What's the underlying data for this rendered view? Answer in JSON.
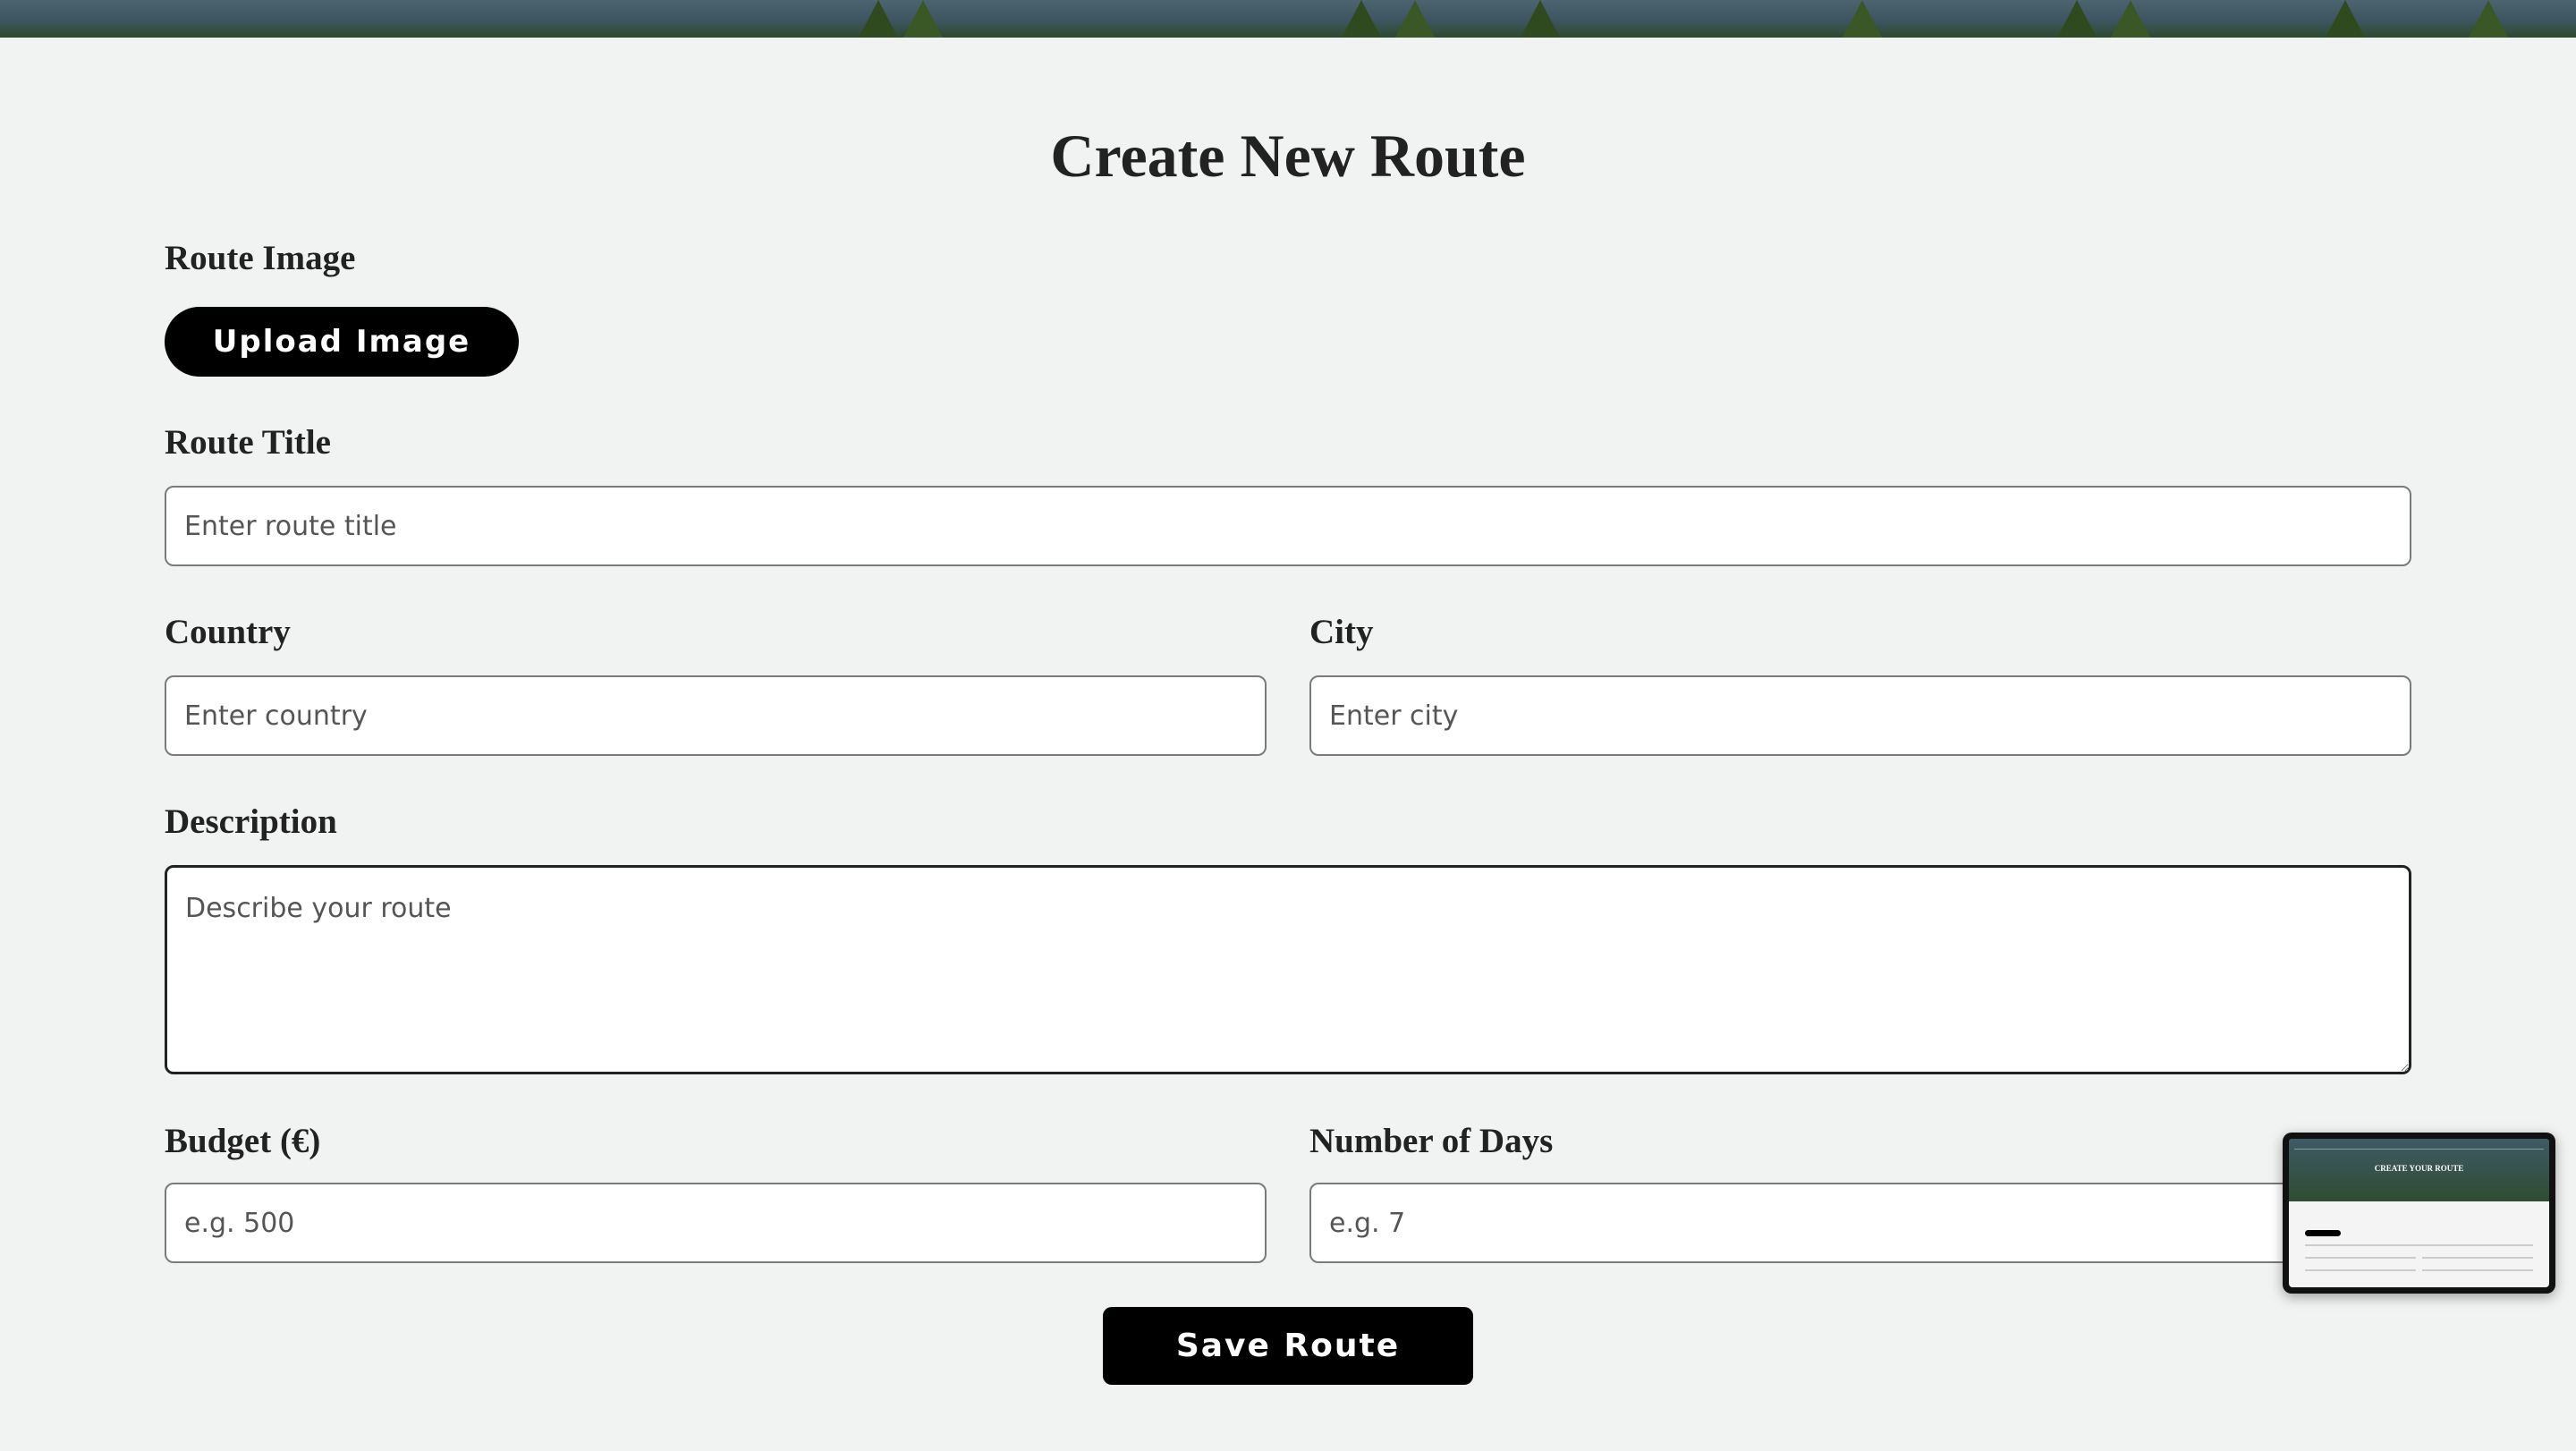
{
  "page": {
    "title": "Create New Route"
  },
  "form": {
    "route_image_label": "Route Image",
    "upload_button": "Upload Image",
    "route_title_label": "Route Title",
    "route_title_placeholder": "Enter route title",
    "country_label": "Country",
    "country_placeholder": "Enter country",
    "city_label": "City",
    "city_placeholder": "Enter city",
    "description_label": "Description",
    "description_placeholder": "Describe your route",
    "budget_label": "Budget (€)",
    "budget_placeholder": "e.g. 500",
    "days_label": "Number of Days",
    "days_placeholder": "e.g. 7",
    "save_button": "Save Route"
  },
  "preview": {
    "hero_title": "CREATE YOUR ROUTE"
  },
  "colors": {
    "background": "#f1f3f2",
    "button": "#000000",
    "button_text": "#ffffff"
  }
}
